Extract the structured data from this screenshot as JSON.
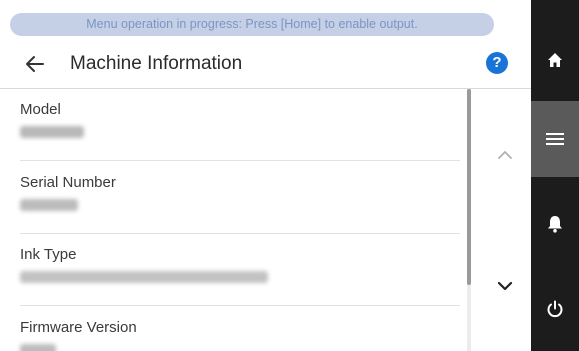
{
  "status_banner": "Menu operation in progress: Press [Home] to enable output.",
  "header": {
    "title": "Machine Information"
  },
  "items": [
    {
      "label": "Model",
      "value_obscured": true
    },
    {
      "label": "Serial Number",
      "value_obscured": true
    },
    {
      "label": "Ink Type",
      "value_obscured": true
    },
    {
      "label": "Firmware Version",
      "value_obscured": true
    }
  ],
  "icons": {
    "back": "arrow-left-icon",
    "help": "question-mark-icon",
    "scroll_up": "chevron-up-icon",
    "scroll_down": "chevron-down-icon",
    "home": "home-icon",
    "menu": "menu-icon",
    "notifications": "bell-icon",
    "power": "power-icon"
  },
  "colors": {
    "accent": "#1a73d6",
    "banner_bg": "#c5d0e6",
    "banner_text": "#7c95c4",
    "sidenav_bg": "#1c1c1c",
    "sidenav_active": "#5a5a5a"
  },
  "help_glyph": "?"
}
